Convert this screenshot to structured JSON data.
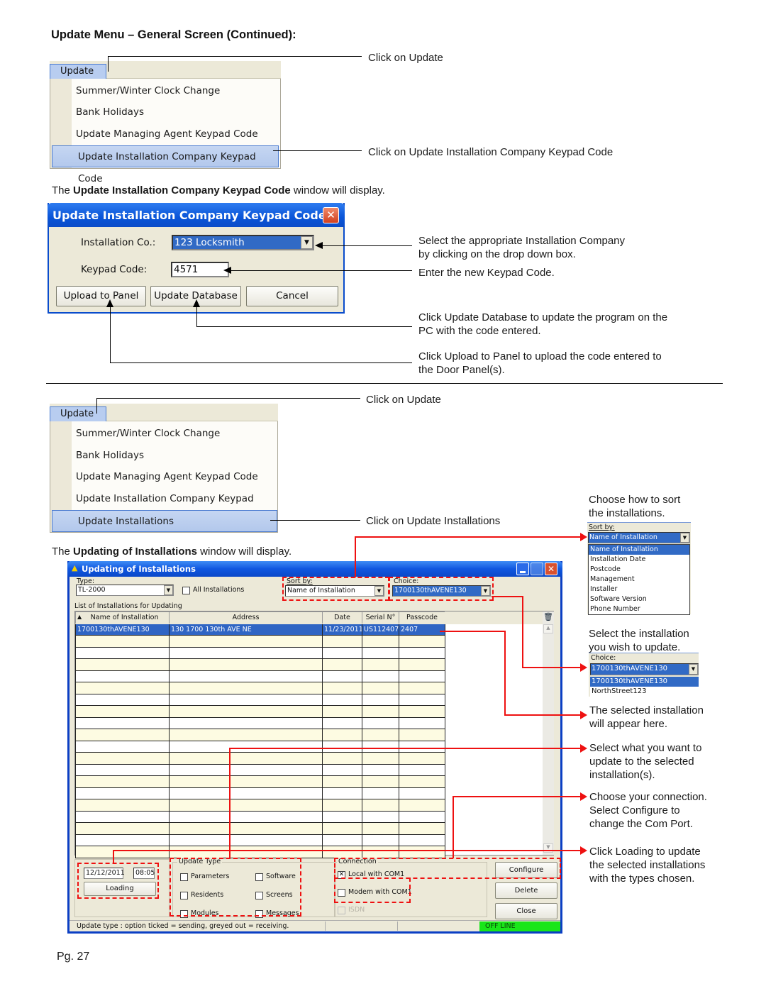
{
  "page": {
    "heading": "Update Menu – General Screen (Continued):",
    "page_number": "Pg. 27"
  },
  "section1": {
    "menu": {
      "title": "Update",
      "items": [
        "Summer/Winter Clock Change",
        "Bank Holidays",
        "Update Managing Agent Keypad Code",
        "Update Installation Company Keypad Code"
      ],
      "highlighted_index": 3
    },
    "callouts": {
      "click_update": "Click on Update",
      "click_item": "Click on Update Installation Company Keypad Code"
    },
    "intro": {
      "pre": "The ",
      "bold": "Update Installation Company Keypad Code",
      "post": " window will display."
    }
  },
  "dialog1": {
    "title": "Update Installation Company Keypad Code",
    "installation_label": "Installation Co.:",
    "installation_value": "123 Locksmith",
    "keypad_label": "Keypad Code:",
    "keypad_value": "4571",
    "buttons": {
      "upload": "Upload to Panel",
      "update_db": "Update Database",
      "cancel": "Cancel"
    },
    "callouts": {
      "select_company": "Select the appropriate Installation Company",
      "select_company_2": "by clicking on the drop down box.",
      "enter_code": "Enter the new Keypad Code.",
      "update_db": "Click Update Database to update the program on the",
      "update_db_2": "PC with the code entered.",
      "upload": "Click Upload to Panel to upload the code entered to",
      "upload_2": "the Door Panel(s)."
    }
  },
  "section2": {
    "menu": {
      "title": "Update",
      "items": [
        "Summer/Winter Clock Change",
        "Bank Holidays",
        "Update Managing Agent Keypad Code",
        "Update Installation Company Keypad Code",
        "Update Installations"
      ],
      "highlighted_index": 4
    },
    "callouts": {
      "click_update": "Click on Update",
      "click_item": "Click on Update Installations"
    },
    "intro": {
      "pre": "The ",
      "bold": "Updating of Installations",
      "post": " window will display."
    }
  },
  "dialog2": {
    "title": "Updating of Installations",
    "type_label": "Type:",
    "type_value": "TL-2000",
    "all_installations_label": "All Installations",
    "sort_label": "Sort by:",
    "sort_value": "Name of Installation",
    "choice_label": "Choice:",
    "choice_value": "1700130thAVENE130",
    "list_label": "List of Installations for Updating",
    "columns": [
      "Name of Installation",
      "Address",
      "Date",
      "Serial N°",
      "Passcode"
    ],
    "rows": [
      [
        "1700130thAVENE130",
        "130 1700 130th AVE NE",
        "11/23/2011",
        "US112407",
        "2407"
      ]
    ],
    "date_value": "12/12/2011",
    "time_value": "08:05",
    "loading_button": "Loading",
    "update_type": {
      "label": "Update Type",
      "options": [
        {
          "label": "Parameters",
          "checked": false
        },
        {
          "label": "Software",
          "checked": false
        },
        {
          "label": "Residents",
          "checked": false
        },
        {
          "label": "Screens",
          "checked": false
        },
        {
          "label": "Modules",
          "checked": false
        },
        {
          "label": "Messages",
          "checked": false
        }
      ]
    },
    "connection": {
      "label": "Connection",
      "options": [
        {
          "label": "Local with COM1",
          "checked": true,
          "disabled": false
        },
        {
          "label": "Modem with COM1",
          "checked": false,
          "disabled": false
        },
        {
          "label": "ISDN",
          "checked": false,
          "disabled": true
        }
      ]
    },
    "buttons": {
      "configure": "Configure",
      "delete": "Delete",
      "close": "Close"
    },
    "status_text": "Update type : option ticked = sending, greyed out = receiving.",
    "status_state": "OFF LINE",
    "status_color": "#19e619"
  },
  "sidebar": {
    "sort_help": [
      "Choose how to sort",
      "the installations."
    ],
    "sort_popup": {
      "label": "Sort by:",
      "value": "Name of Installation",
      "options": [
        "Name of Installation",
        "Installation Date",
        "Postcode",
        "Management",
        "Installer",
        "Software Version",
        "Phone Number"
      ]
    },
    "choice_help": [
      "Select the installation",
      "you wish to update."
    ],
    "choice_popup": {
      "label": "Choice:",
      "value": "1700130thAVENE130",
      "options": [
        "1700130thAVENE130",
        "NorthStreet123"
      ]
    },
    "selected_help": [
      "The selected installation",
      "will appear here."
    ],
    "update_help": [
      "Select what you want to",
      "update to the selected",
      "installation(s)."
    ],
    "connection_help": [
      "Choose your connection.",
      "Select Configure to",
      "change the Com Port."
    ],
    "loading_help": [
      "Click Loading to update",
      "the selected installations",
      "with the types chosen."
    ]
  },
  "colors": {
    "annotation_red": "#ee1111",
    "xp_blue": "#0a55d8",
    "selection_blue": "#316ac5"
  }
}
